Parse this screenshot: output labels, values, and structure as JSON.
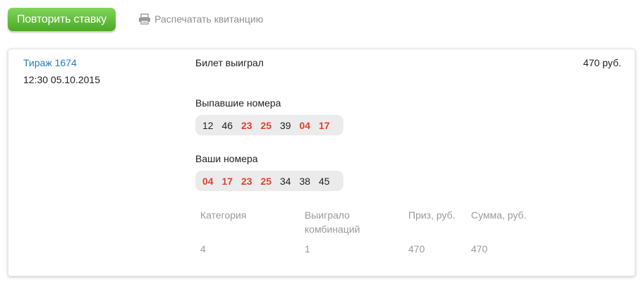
{
  "toolbar": {
    "repeat_label": "Повторить ставку",
    "print_label": "Распечатать квитанцию",
    "print_icon": "printer-icon"
  },
  "ticket": {
    "draw_label": "Тираж 1674",
    "datetime": "12:30 05.10.2015",
    "status": "Билет выиграл",
    "amount": "470 руб."
  },
  "drawn_numbers": {
    "label": "Выпавшие номера",
    "items": [
      {
        "value": "12",
        "hit": false
      },
      {
        "value": "46",
        "hit": false
      },
      {
        "value": "23",
        "hit": true
      },
      {
        "value": "25",
        "hit": true
      },
      {
        "value": "39",
        "hit": false
      },
      {
        "value": "04",
        "hit": true
      },
      {
        "value": "17",
        "hit": true
      }
    ]
  },
  "your_numbers": {
    "label": "Ваши номера",
    "items": [
      {
        "value": "04",
        "hit": true
      },
      {
        "value": "17",
        "hit": true
      },
      {
        "value": "23",
        "hit": true
      },
      {
        "value": "25",
        "hit": true
      },
      {
        "value": "34",
        "hit": false
      },
      {
        "value": "38",
        "hit": false
      },
      {
        "value": "45",
        "hit": false
      }
    ]
  },
  "results_table": {
    "headers": [
      "Категория",
      "Выиграло\nкомбинаций",
      "Приз, руб.",
      "Сумма, руб."
    ],
    "rows": [
      [
        "4",
        "1",
        "470",
        "470"
      ]
    ]
  },
  "colors": {
    "accent_green": "#5cbb32",
    "link_blue": "#2a7ab8",
    "hit_red": "#e0432e",
    "muted_gray": "#9a9a9a"
  }
}
